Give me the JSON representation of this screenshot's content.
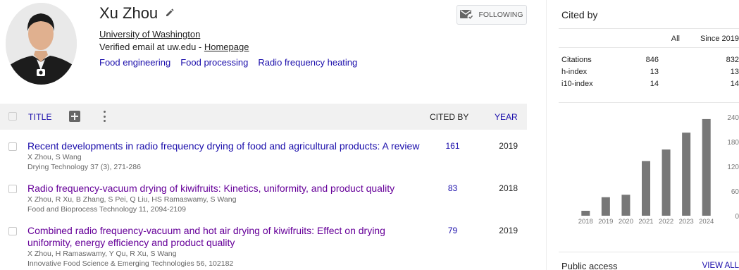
{
  "profile": {
    "name": "Xu Zhou",
    "affiliation": "University of Washington",
    "verified_prefix": "Verified email at uw.edu - ",
    "homepage_label": "Homepage",
    "interests": [
      "Food engineering",
      "Food processing",
      "Radio frequency heating"
    ],
    "follow_label": "FOLLOWING"
  },
  "table": {
    "title_header": "TITLE",
    "cited_header": "CITED BY",
    "year_header": "YEAR",
    "rows": [
      {
        "title": "Recent developments in radio frequency drying of food and agricultural products: A review",
        "authors": "X Zhou, S Wang",
        "venue": "Drying Technology 37 (3), 271-286",
        "cited_by": "161",
        "year": "2019"
      },
      {
        "title": "Radio frequency-vacuum drying of kiwifruits: Kinetics, uniformity, and product quality",
        "authors": "X Zhou, R Xu, B Zhang, S Pei, Q Liu, HS Ramaswamy, S Wang",
        "venue": "Food and Bioprocess Technology 11, 2094-2109",
        "cited_by": "83",
        "year": "2018"
      },
      {
        "title": "Combined radio frequency-vacuum and hot air drying of kiwifruits: Effect on drying uniformity, energy efficiency and product quality",
        "authors": "X Zhou, H Ramaswamy, Y Qu, R Xu, S Wang",
        "venue": "Innovative Food Science & Emerging Technologies 56, 102182",
        "cited_by": "79",
        "year": "2019"
      }
    ]
  },
  "cited_by": {
    "title": "Cited by",
    "col_all": "All",
    "col_since": "Since 2019",
    "metrics": [
      {
        "label": "Citations",
        "all": "846",
        "since": "832"
      },
      {
        "label": "h-index",
        "all": "13",
        "since": "13"
      },
      {
        "label": "i10-index",
        "all": "14",
        "since": "14"
      }
    ]
  },
  "chart_data": {
    "type": "bar",
    "categories": [
      "2018",
      "2019",
      "2020",
      "2021",
      "2022",
      "2023",
      "2024"
    ],
    "values": [
      12,
      45,
      51,
      133,
      161,
      202,
      235
    ],
    "yticks": [
      0,
      60,
      120,
      180,
      240
    ],
    "ylim": [
      0,
      240
    ],
    "title": "",
    "xlabel": "",
    "ylabel": "",
    "bar_color": "#777777",
    "grid": false
  },
  "public_access": {
    "title": "Public access",
    "view_all": "VIEW ALL"
  }
}
